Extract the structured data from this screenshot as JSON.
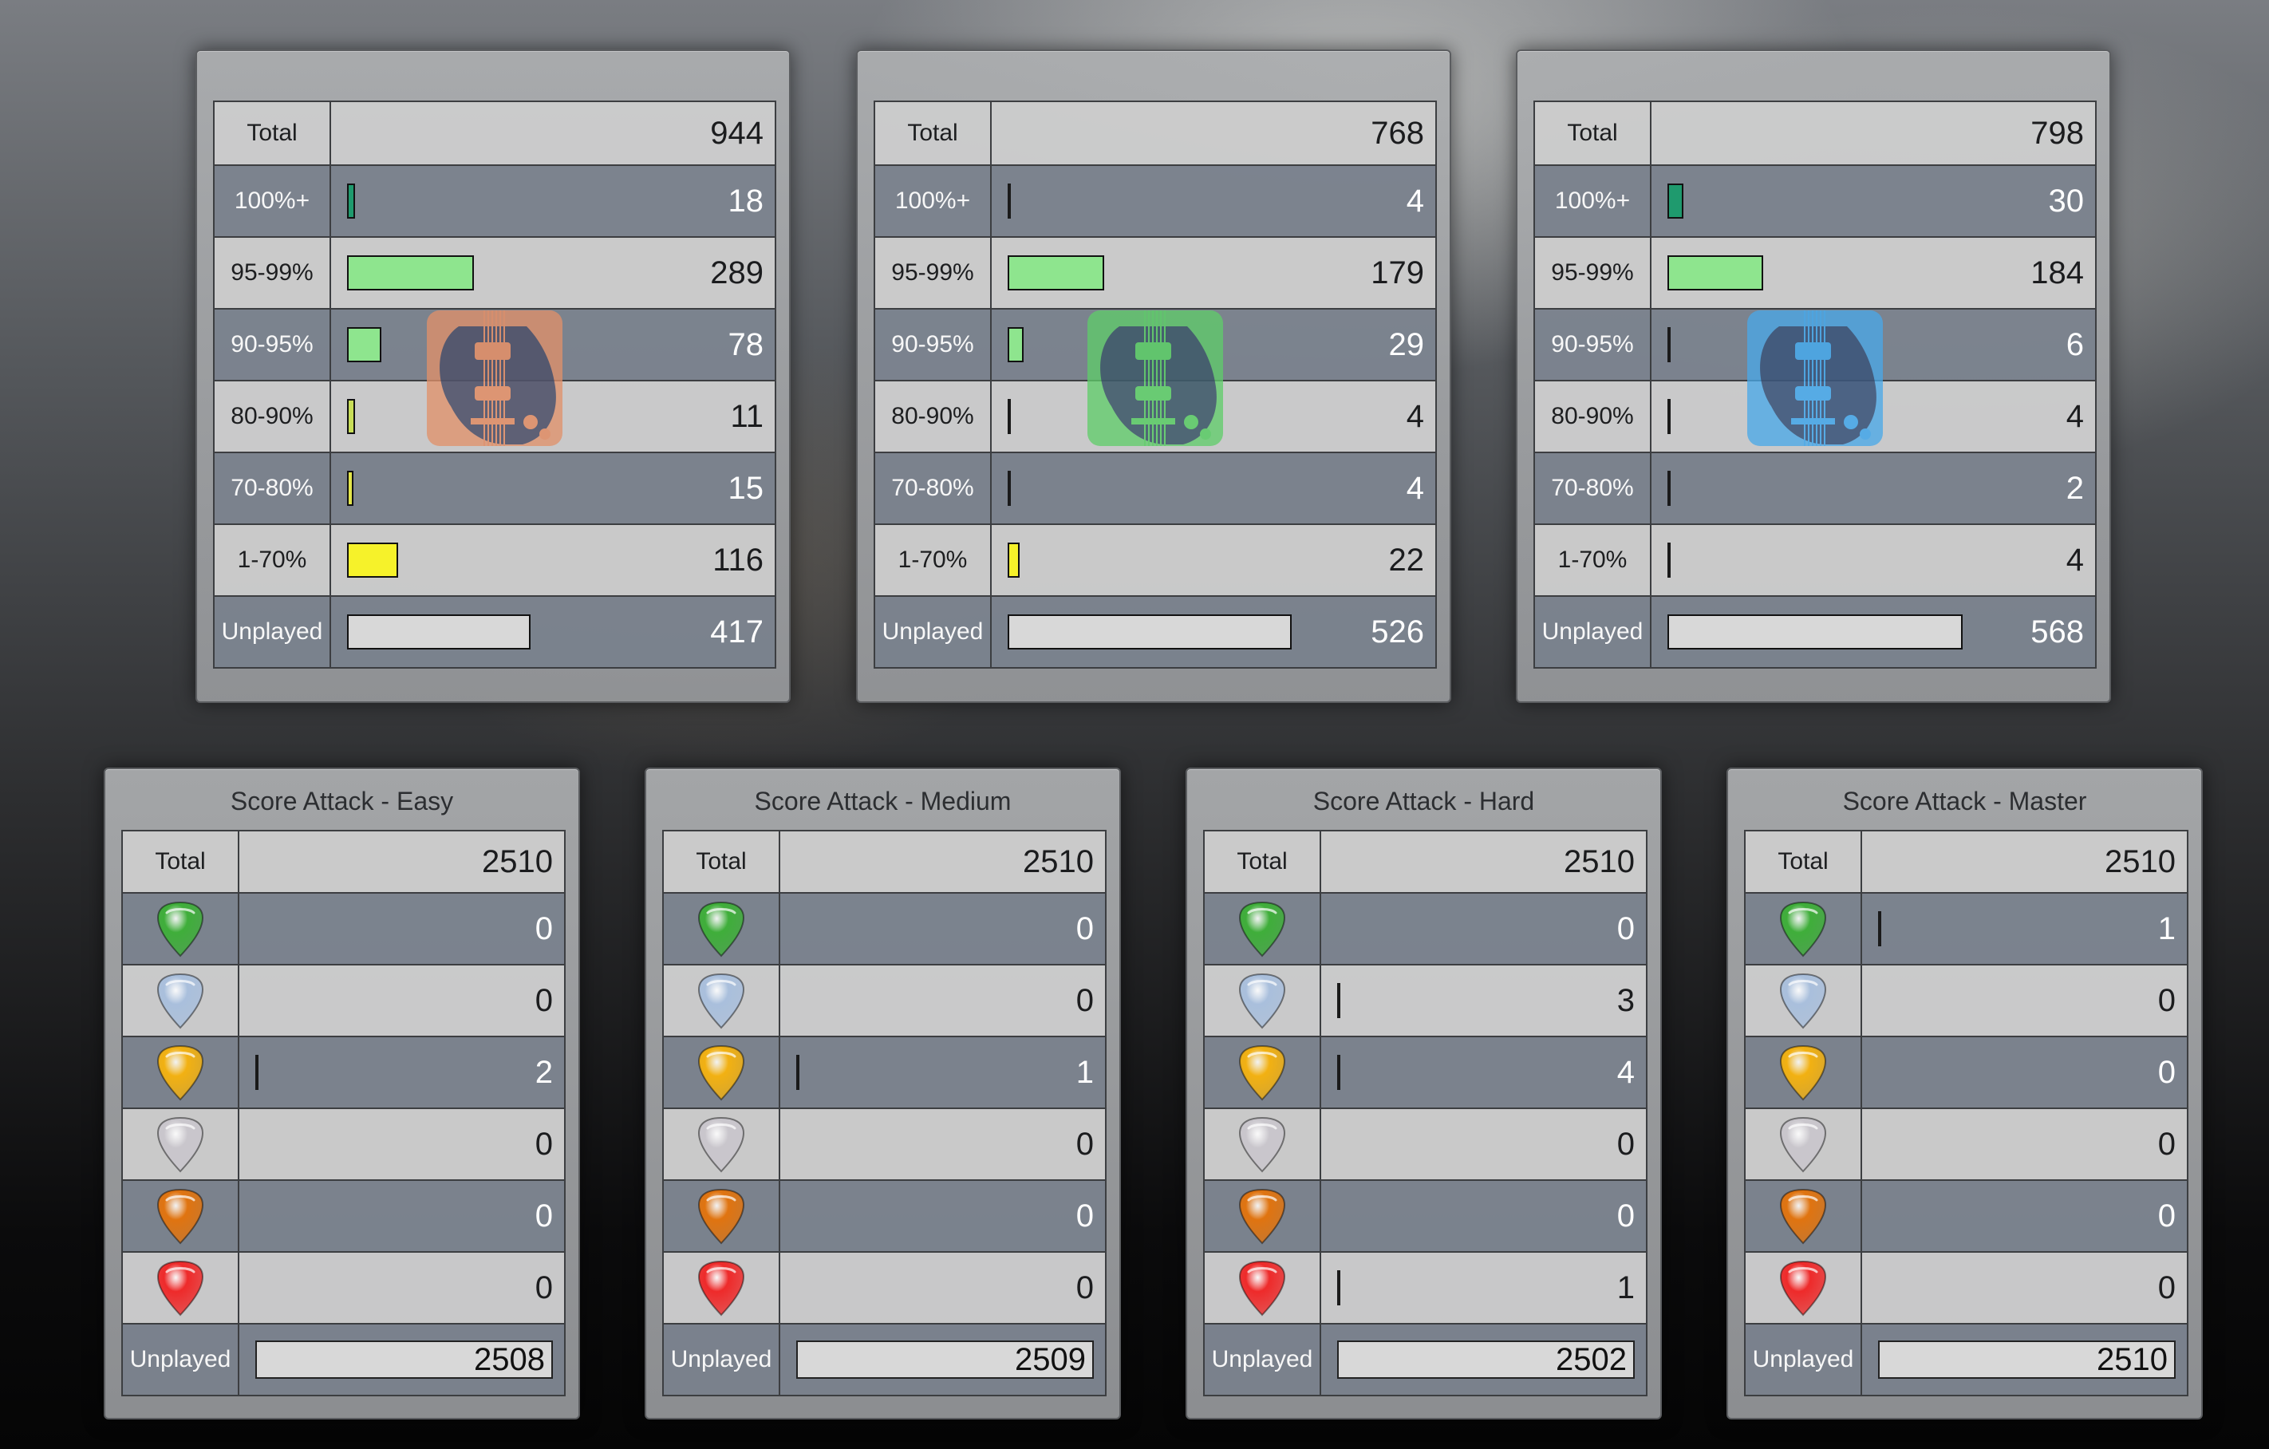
{
  "row_labels": {
    "total": "Total",
    "p100": "100%+",
    "p95": "95-99%",
    "p90": "90-95%",
    "p80": "80-90%",
    "p70": "70-80%",
    "p1": "1-70%",
    "unplayed": "Unplayed"
  },
  "accuracy_panels": [
    {
      "instrument_icon": "lead-guitar-icon",
      "icon_color": "#e0906a",
      "total": "944",
      "p100": "18",
      "p95": "289",
      "p90": "78",
      "p80": "11",
      "p70": "15",
      "p1": "116",
      "unplayed": "417"
    },
    {
      "instrument_icon": "rhythm-guitar-icon",
      "icon_color": "#5fcc6a",
      "total": "768",
      "p100": "4",
      "p95": "179",
      "p90": "29",
      "p80": "4",
      "p70": "4",
      "p1": "22",
      "unplayed": "526"
    },
    {
      "instrument_icon": "bass-guitar-icon",
      "icon_color": "#4aa8e8",
      "total": "798",
      "p100": "30",
      "p95": "184",
      "p90": "6",
      "p80": "4",
      "p70": "2",
      "p1": "4",
      "unplayed": "568"
    }
  ],
  "bar_colors": {
    "p100": "#1f9a6e",
    "p95": "#8ee58e",
    "p90": "#8ee58e",
    "p80": "#c8de58",
    "p70": "#e3e54a",
    "p1": "#f6f22a",
    "unplayed": "#d8d8d8"
  },
  "pick_icons": [
    "platinum-pick-icon",
    "diamond-pick-icon",
    "gold-pick-icon",
    "silver-pick-icon",
    "bronze-pick-icon",
    "red-pick-icon"
  ],
  "pick_colors": [
    "#3fae3a",
    "#a9bfdc",
    "#f2b112",
    "#c9c6cc",
    "#e07410",
    "#ee2a2a"
  ],
  "score_attack_panels": [
    {
      "title": "Score Attack - Easy",
      "total": "2510",
      "picks": [
        "0",
        "0",
        "2",
        "0",
        "0",
        "0"
      ],
      "unplayed": "2508"
    },
    {
      "title": "Score Attack - Medium",
      "total": "2510",
      "picks": [
        "0",
        "0",
        "1",
        "0",
        "0",
        "0"
      ],
      "unplayed": "2509"
    },
    {
      "title": "Score Attack - Hard",
      "total": "2510",
      "picks": [
        "0",
        "3",
        "4",
        "0",
        "0",
        "1"
      ],
      "unplayed": "2502"
    },
    {
      "title": "Score Attack - Master",
      "total": "2510",
      "picks": [
        "1",
        "0",
        "0",
        "0",
        "0",
        "0"
      ],
      "unplayed": "2510"
    }
  ]
}
